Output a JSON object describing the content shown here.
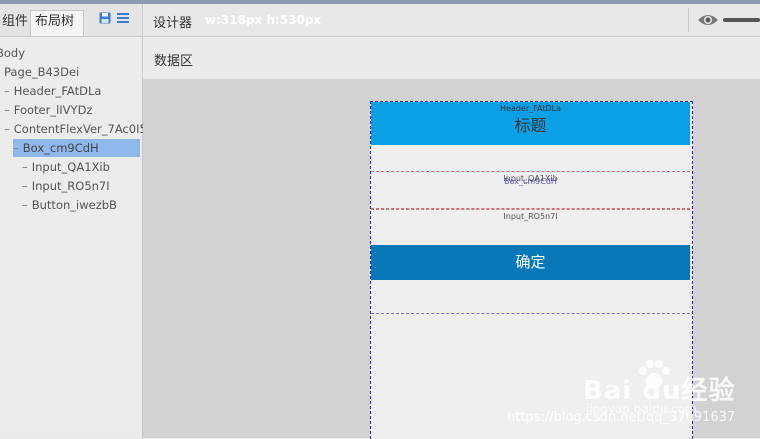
{
  "left_panel": {
    "tabs": [
      "组件",
      "布局树"
    ],
    "icons": [
      "save-icon",
      "list-icon"
    ],
    "tree": [
      {
        "label": "Body",
        "dash": ""
      },
      {
        "label": "Page_B43Dei",
        "dash": ""
      },
      {
        "label": "Header_FAtDLa",
        "dash": "–"
      },
      {
        "label": "Footer_lIVYDz",
        "dash": "–"
      },
      {
        "label": "ContentFlexVer_7Ac0I5",
        "dash": "–"
      },
      {
        "label": "Box_cm9CdH",
        "dash": "–",
        "selected": true
      },
      {
        "label": "Input_QA1Xib",
        "dash": "–"
      },
      {
        "label": "Input_RO5n7I",
        "dash": "–"
      },
      {
        "label": "Button_iwezbB",
        "dash": "–"
      }
    ]
  },
  "topbar": {
    "designer_label": "设计器",
    "size_label": "w:318px h:530px"
  },
  "databar": {
    "label": "数据区"
  },
  "canvas": {
    "header_tag": "Header_FAtDLa",
    "header_title": "标题",
    "input1_tag": "Input_QA1Xib",
    "input1_tag2": "Box_cm9CdH",
    "input2_tag": "Input_RO5n7I",
    "button_label": "确定"
  },
  "watermark": {
    "logo": "Bai  du经验",
    "sub": "jingyan.baidu.com",
    "url": "https://blog.csdn.net/qq_37691637"
  },
  "colors": {
    "header_bg": "#0ba0e6",
    "button_bg": "#0878b8",
    "selection": "#8fb8ec",
    "frame_border": "#2a22b8"
  }
}
